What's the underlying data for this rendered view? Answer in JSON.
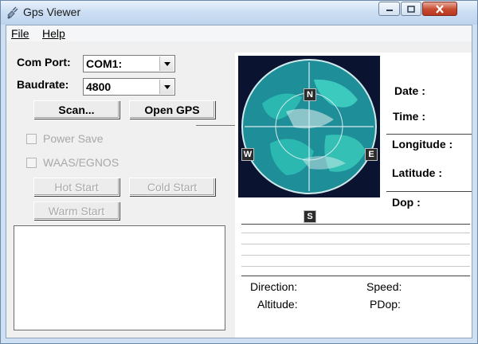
{
  "window": {
    "title": "Gps Viewer"
  },
  "menu": {
    "file": "File",
    "help": "Help"
  },
  "controls": {
    "com_port_label": "Com Port:",
    "com_port_value": "COM1:",
    "baudrate_label": "Baudrate:",
    "baudrate_value": "4800",
    "scan_button": "Scan...",
    "open_gps_button": "Open GPS",
    "power_save_label": "Power Save",
    "waas_label": "WAAS/EGNOS",
    "hot_start_button": "Hot Start",
    "cold_start_button": "Cold Start",
    "warm_start_button": "Warm Start"
  },
  "compass": {
    "north": "N",
    "south": "S",
    "east": "E",
    "west": "W"
  },
  "info": {
    "date": "Date :",
    "time": "Time :",
    "longitude": "Longitude :",
    "latitude": "Latitude :",
    "dop": "Dop :"
  },
  "status": {
    "direction": "Direction:",
    "speed": "Speed:",
    "altitude": "Altitude:",
    "pdop": "PDop:"
  },
  "colors": {
    "globe_ocean": "#2bb8b0",
    "globe_dark": "#0b1a3a",
    "close_red": "#c74b2f",
    "window_frame": "#cfe0f3"
  }
}
